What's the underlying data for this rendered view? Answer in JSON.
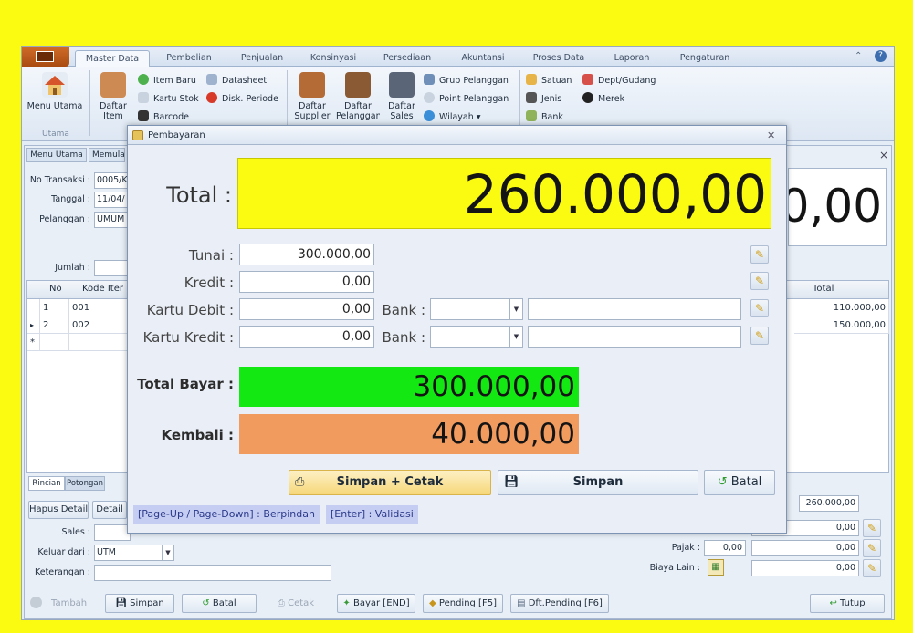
{
  "ribbon_tabs": [
    "Master Data",
    "Pembelian",
    "Penjualan",
    "Konsinyasi",
    "Persediaan",
    "Akuntansi",
    "Proses Data",
    "Laporan",
    "Pengaturan"
  ],
  "ribbon": {
    "menu_utama": "Menu Utama",
    "utama_group": "Utama",
    "daftar_item": "Daftar Item",
    "item_baru": "Item Baru",
    "kartu_stok": "Kartu Stok",
    "barcode": "Barcode",
    "datasheet": "Datasheet",
    "disk_periode": "Disk. Periode",
    "daftar_supplier": "Daftar Supplier",
    "daftar_pelanggan": "Daftar Pelanggan",
    "daftar_sales": "Daftar Sales",
    "grup_pelanggan": "Grup Pelanggan",
    "point_pelanggan": "Point Pelanggan",
    "wilayah": "Wilayah",
    "satuan": "Satuan",
    "jenis": "Jenis",
    "bank": "Bank",
    "dept_gudang": "Dept/Gudang",
    "merek": "Merek"
  },
  "doc_tabs": [
    "Menu Utama",
    "Memula"
  ],
  "form": {
    "no_transaksi_label": "No Transaksi :",
    "no_transaksi": "0005/K",
    "tanggal_label": "Tanggal :",
    "tanggal": "11/04/",
    "pelanggan_label": "Pelanggan :",
    "pelanggan": "UMUM",
    "jumlah_label": "Jumlah :"
  },
  "background_total": "0,00",
  "grid": {
    "headers": {
      "no": "No",
      "kode": "Kode Iter",
      "total": "Total"
    },
    "rows": [
      {
        "no": "1",
        "kode": "001",
        "total": "110.000,00"
      },
      {
        "no": "2",
        "kode": "002",
        "total": "150.000,00"
      }
    ],
    "new_row_marker": "*",
    "current_row_marker": "▸"
  },
  "bottom_tabs": [
    "Rincian",
    "Potongan"
  ],
  "detail_buttons": [
    "Hapus Detail",
    "Detail"
  ],
  "lower": {
    "sales_label": "Sales :",
    "keluar_dari_label": "Keluar dari :",
    "keluar_dari": "UTM",
    "keterangan_label": "Keterangan :",
    "subtotal": "260.000,00",
    "potongan": "0,00",
    "pajak_label": "Pajak :",
    "pajak_pct": "0,00",
    "pajak": "0,00",
    "biaya_lain_label": "Biaya Lain :",
    "biaya_lain": "0,00"
  },
  "toolbar": {
    "tambah": "Tambah",
    "simpan": "Simpan",
    "batal": "Batal",
    "cetak": "Cetak",
    "bayar": "Bayar [END]",
    "pending": "Pending [F5]",
    "dft_pending": "Dft.Pending [F6]",
    "tutup": "Tutup"
  },
  "dialog": {
    "title": "Pembayaran",
    "total_label": "Total :",
    "total": "260.000,00",
    "tunai_label": "Tunai :",
    "tunai": "300.000,00",
    "kredit_label": "Kredit :",
    "kredit": "0,00",
    "kartu_debit_label": "Kartu Debit :",
    "kartu_debit": "0,00",
    "kartu_kredit_label": "Kartu Kredit :",
    "kartu_kredit": "0,00",
    "bank_label": "Bank :",
    "total_bayar_label": "Total Bayar :",
    "total_bayar": "300.000,00",
    "kembali_label": "Kembali :",
    "kembali": "40.000,00",
    "simpan_cetak": "Simpan + Cetak",
    "simpan": "Simpan",
    "batal": "Batal",
    "hint_nav": "[Page-Up / Page-Down] : Berpindah",
    "hint_enter": "[Enter] : Validasi"
  },
  "colors": {
    "background": "#fbfb12",
    "total_box": "#fbfb12",
    "total_bayar_box": "#13e813",
    "kembali_box": "#f29b5f"
  }
}
